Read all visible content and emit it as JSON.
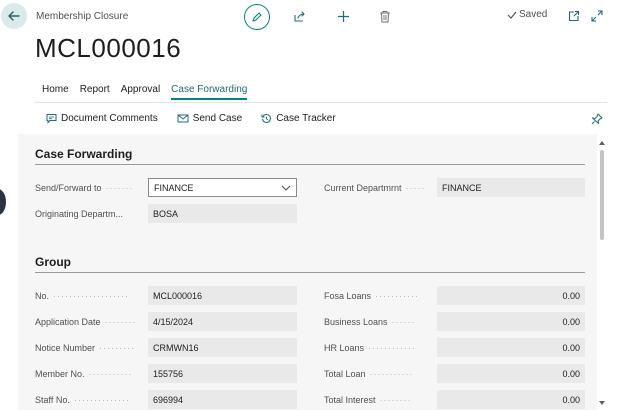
{
  "header": {
    "caption": "Membership Closure",
    "record_no": "MCL000016",
    "saved_label": "Saved"
  },
  "tabs": [
    {
      "label": "Home"
    },
    {
      "label": "Report"
    },
    {
      "label": "Approval"
    },
    {
      "label": "Case Forwarding",
      "active": true
    }
  ],
  "actions": [
    {
      "label": "Document Comments",
      "icon": "comment-icon"
    },
    {
      "label": "Send Case",
      "icon": "send-icon"
    },
    {
      "label": "Case Tracker",
      "icon": "history-icon"
    }
  ],
  "case_forwarding": {
    "title": "Case Forwarding",
    "send_forward_label": "Send/Forward to",
    "send_forward_value": "FINANCE",
    "current_dept_label": "Current Departmrnt",
    "current_dept_value": "FINANCE",
    "originating_label": "Originating Departm...",
    "originating_value": "BOSA"
  },
  "group": {
    "title": "Group",
    "left": [
      {
        "label": "No.",
        "value": "MCL000016"
      },
      {
        "label": "Application Date",
        "value": "4/15/2024"
      },
      {
        "label": "Notice Number",
        "value": "CRMWN16"
      },
      {
        "label": "Member No.",
        "value": "155756"
      },
      {
        "label": "Staff No.",
        "value": "696994"
      }
    ],
    "right": [
      {
        "label": "Fosa Loans",
        "value": "0.00"
      },
      {
        "label": "Business Loans",
        "value": "0.00"
      },
      {
        "label": "HR Loans",
        "value": "0.00"
      },
      {
        "label": "Total Loan",
        "value": "0.00"
      },
      {
        "label": "Total Interest",
        "value": "0.00"
      }
    ]
  },
  "colors": {
    "accent": "#008489",
    "field_bg": "#e9e9e9",
    "panel_bg": "#f6f6f6"
  }
}
